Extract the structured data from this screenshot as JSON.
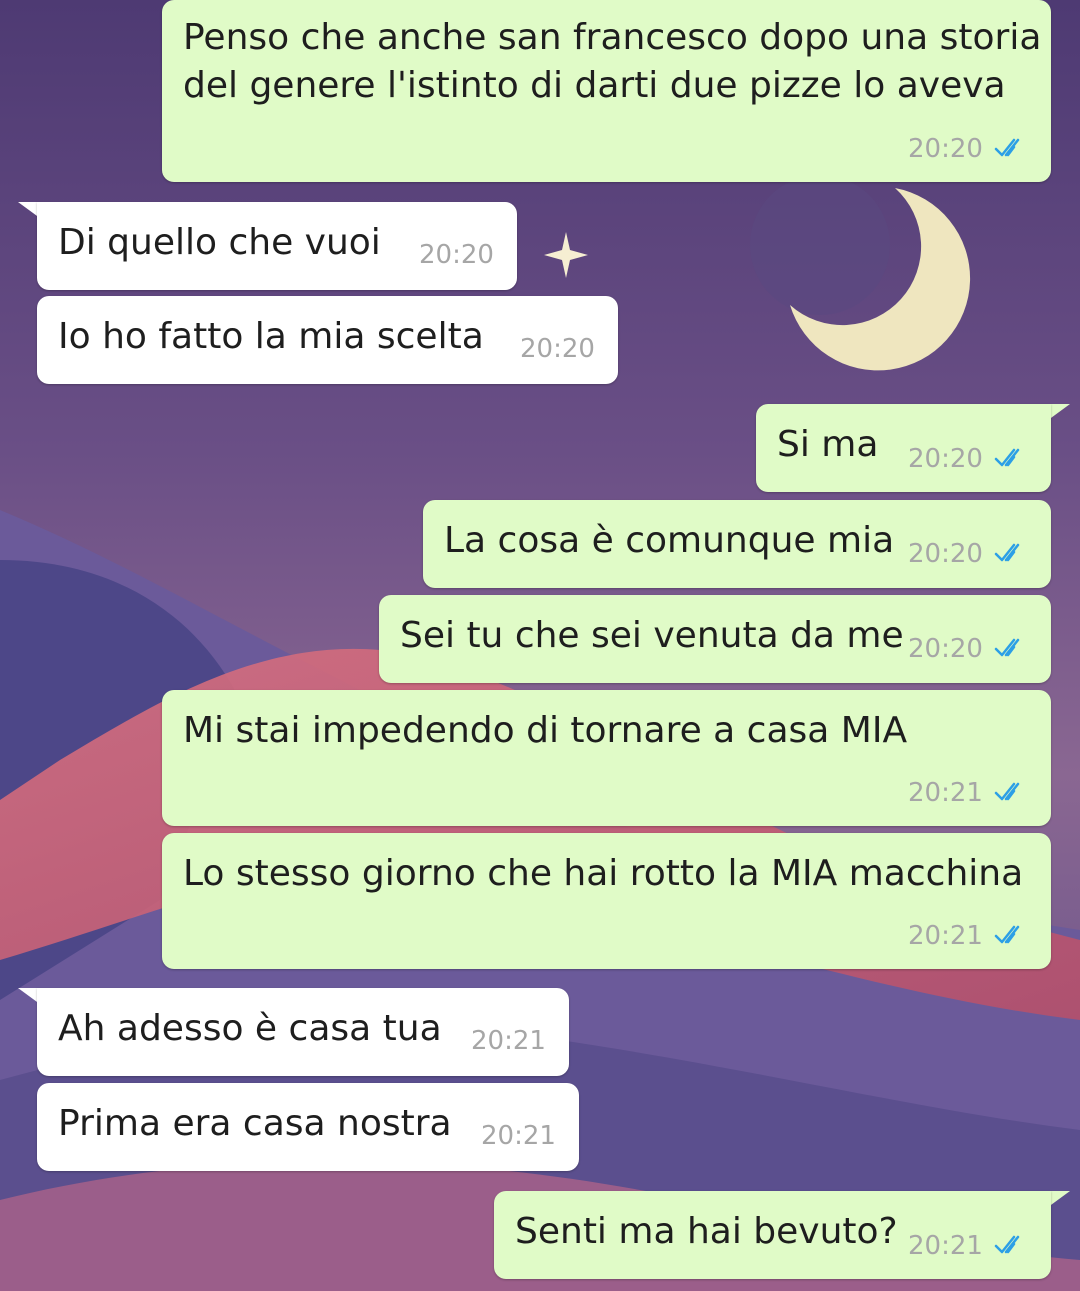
{
  "theme": {
    "outgoing_bubble_color": "#e0fbc7",
    "incoming_bubble_color": "#ffffff",
    "read_tick_color": "#2c9fe6",
    "timestamp_color": "#a6a6a6",
    "wallpaper": "purple desert night with crescent moon and star"
  },
  "messages": [
    {
      "direction": "outgoing",
      "lines": [
        "Penso che anche san francesco dopo una storia",
        "del genere l'istinto di darti due pizze lo aveva"
      ],
      "time": "20:20",
      "status": "read"
    },
    {
      "direction": "incoming",
      "text": "Di quello che vuoi",
      "time": "20:20"
    },
    {
      "direction": "incoming",
      "text": "Io ho fatto la mia scelta",
      "time": "20:20"
    },
    {
      "direction": "outgoing",
      "text": "Si ma",
      "time": "20:20",
      "status": "read"
    },
    {
      "direction": "outgoing",
      "text": "La cosa è comunque mia",
      "time": "20:20",
      "status": "read"
    },
    {
      "direction": "outgoing",
      "text": "Sei tu che sei venuta da me",
      "time": "20:20",
      "status": "read"
    },
    {
      "direction": "outgoing",
      "text": "Mi stai impedendo di tornare a casa MIA",
      "time": "20:21",
      "status": "read"
    },
    {
      "direction": "outgoing",
      "text": "Lo stesso giorno che hai rotto la MIA macchina",
      "time": "20:21",
      "status": "read"
    },
    {
      "direction": "incoming",
      "text": "Ah adesso è casa tua",
      "time": "20:21"
    },
    {
      "direction": "incoming",
      "text": "Prima era casa nostra",
      "time": "20:21"
    },
    {
      "direction": "outgoing",
      "text": "Senti ma hai bevuto?",
      "time": "20:21",
      "status": "read"
    }
  ]
}
